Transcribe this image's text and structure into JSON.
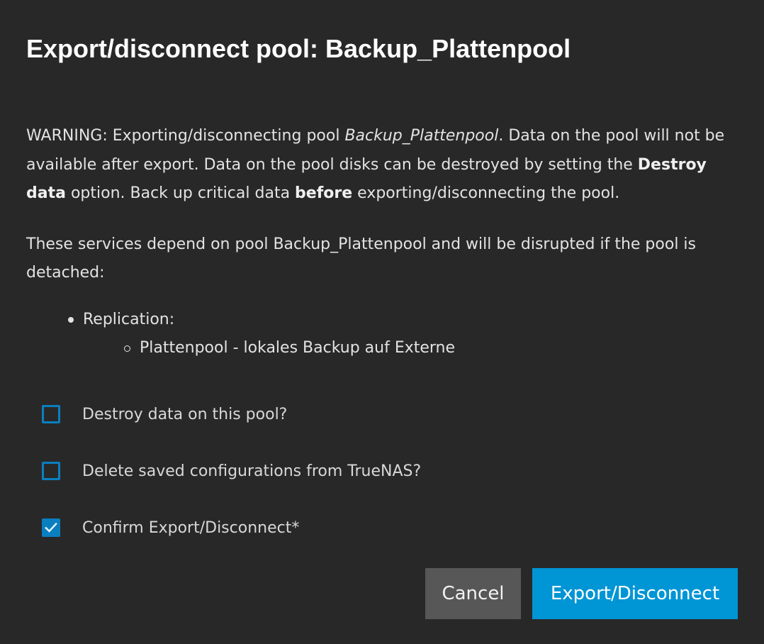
{
  "dialog": {
    "title": "Export/disconnect pool: Backup_Plattenpool"
  },
  "warning": {
    "prefix": "WARNING: Exporting/disconnecting pool ",
    "pool_name": "Backup_Plattenpool",
    "part2": ". Data on the pool will not be available after export. Data on the pool disks can be destroyed by setting the ",
    "destroy_option": "Destroy data",
    "part3": " option. Back up critical data ",
    "before": "before",
    "part4": " exporting/disconnecting the pool."
  },
  "services": {
    "intro": "These services depend on pool Backup_Plattenpool and will be disrupted if the pool is detached:",
    "items": [
      {
        "label": "Replication:",
        "children": [
          "Plattenpool - lokales Backup auf Externe"
        ]
      }
    ]
  },
  "options": {
    "destroy_data": {
      "label": "Destroy data on this pool?",
      "checked": false
    },
    "delete_config": {
      "label": "Delete saved configurations from TrueNAS?",
      "checked": false
    },
    "confirm": {
      "label": "Confirm Export/Disconnect*",
      "checked": true
    }
  },
  "actions": {
    "cancel_label": "Cancel",
    "export_label": "Export/Disconnect"
  },
  "colors": {
    "background": "#282828",
    "checkbox_accent": "#0a7fc0",
    "primary_button": "#0095d5",
    "secondary_button": "#575757"
  }
}
